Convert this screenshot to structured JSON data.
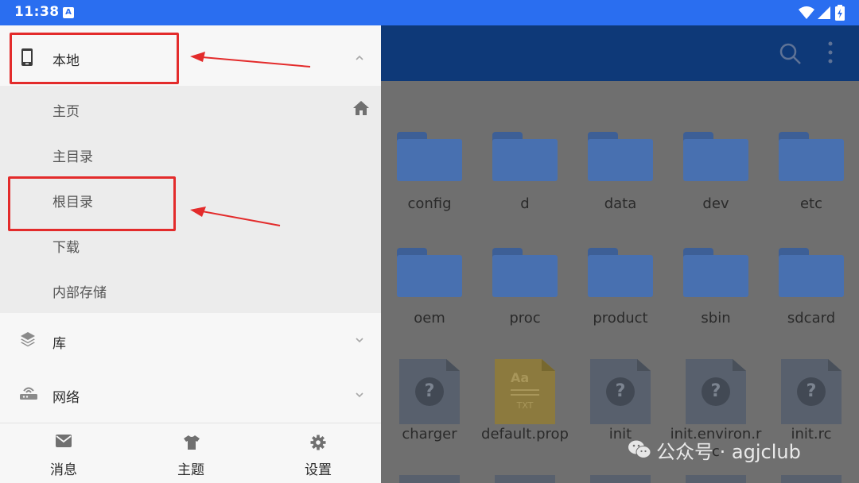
{
  "status_bar": {
    "time": "11:38",
    "badge": "A"
  },
  "toolbar": {
    "search_icon": "search-icon",
    "menu_icon": "more-vert-icon"
  },
  "drawer": {
    "local": {
      "label": "本地",
      "icon": "phone-icon",
      "expanded": true
    },
    "sub_items": [
      {
        "label": "主页",
        "icon": "home-icon"
      },
      {
        "label": "主目录"
      },
      {
        "label": "根目录"
      },
      {
        "label": "下载"
      },
      {
        "label": "内部存储"
      }
    ],
    "library": {
      "label": "库",
      "icon": "layers-icon"
    },
    "network": {
      "label": "网络",
      "icon": "router-icon"
    },
    "bottom_nav": [
      {
        "label": "消息",
        "icon": "mail-icon"
      },
      {
        "label": "主题",
        "icon": "tshirt-icon"
      },
      {
        "label": "设置",
        "icon": "gear-icon"
      }
    ]
  },
  "files": {
    "row1": [
      "config",
      "d",
      "data",
      "dev",
      "etc"
    ],
    "row2": [
      "oem",
      "proc",
      "product",
      "sbin",
      "sdcard"
    ],
    "row3": [
      "charger",
      "default.prop",
      "init",
      "init.environ.rc",
      "init.rc"
    ]
  },
  "txt_icon": {
    "glyph": "Aa",
    "ext": "TXT"
  },
  "watermark": {
    "text": "公众号 · agjclub"
  },
  "colors": {
    "status_bar": "#2a6ef0",
    "toolbar": "#0e3978",
    "folder": "#4870b0",
    "annotation": "#e32b2b"
  }
}
